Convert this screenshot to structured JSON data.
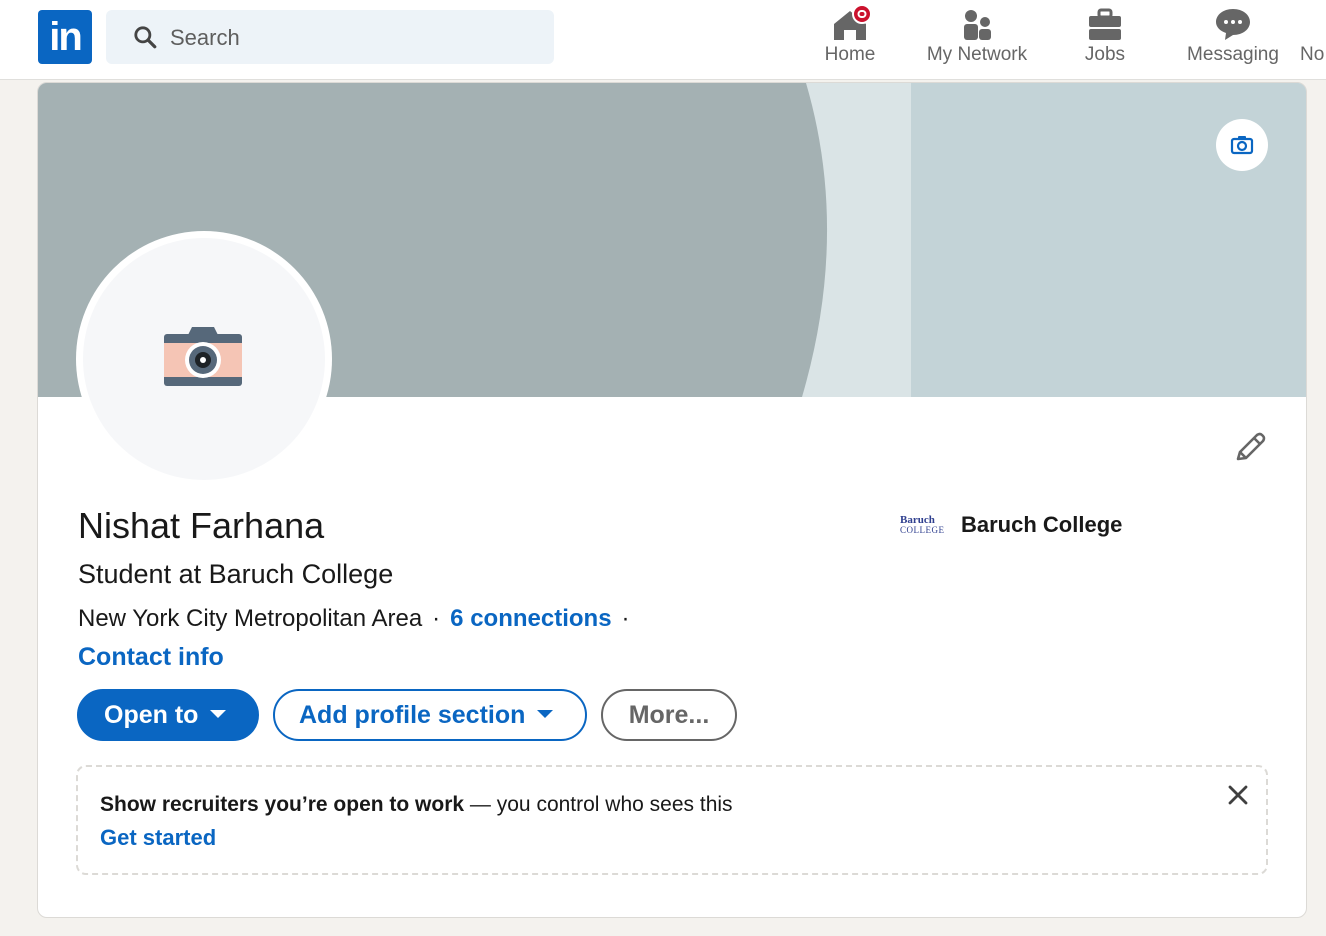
{
  "nav": {
    "logo": "in",
    "search_placeholder": "Search",
    "items": [
      {
        "label": "Home",
        "icon": "home-icon"
      },
      {
        "label": "My Network",
        "icon": "network-icon"
      },
      {
        "label": "Jobs",
        "icon": "briefcase-icon"
      },
      {
        "label": "Messaging",
        "icon": "messaging-icon"
      },
      {
        "label": "No",
        "icon": "bell-icon"
      }
    ]
  },
  "profile": {
    "name": "Nishat Farhana",
    "headline": "Student at Baruch College",
    "location": "New York City Metropolitan Area",
    "separator": "·",
    "connections": "6 connections",
    "contact_info": "Contact info",
    "education": {
      "logo_text": "Baruch",
      "logo_subtext": "COLLEGE",
      "name": "Baruch College"
    }
  },
  "actions": {
    "open_to": "Open to",
    "add_section": "Add profile section",
    "more": "More..."
  },
  "open_to_work": {
    "bold": "Show recruiters you’re open to work",
    "rest": " — you control who sees this",
    "link": "Get started"
  },
  "colors": {
    "brand": "#0a66c2",
    "banner_dark": "#a4b1b3",
    "banner_light": "#c3d3d7",
    "notification_badge": "#cb112d"
  }
}
